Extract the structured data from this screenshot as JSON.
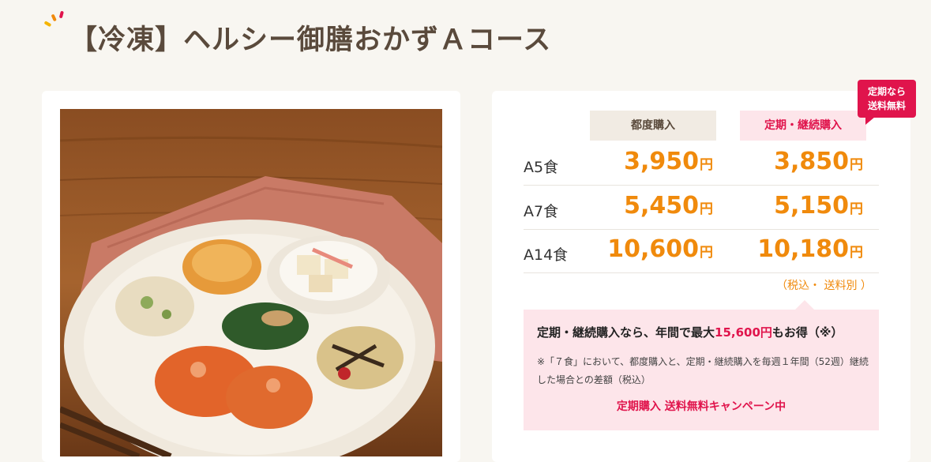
{
  "page": {
    "title": "【冷凍】ヘルシー御膳おかずＡコース"
  },
  "pricing": {
    "columns": {
      "normal": "都度購入",
      "subscription": "定期・継続購入"
    },
    "badge": {
      "line1": "定期なら",
      "line2": "送料無料"
    },
    "rows": [
      {
        "label": "A5食",
        "normal_price": "3,950",
        "subscription_price": "3,850"
      },
      {
        "label": "A7食",
        "normal_price": "5,450",
        "subscription_price": "5,150"
      },
      {
        "label": "A14食",
        "normal_price": "10,600",
        "subscription_price": "10,180"
      }
    ],
    "yen": "円",
    "tax_note": "（税込・ 送料別 ）"
  },
  "info": {
    "main_before": "定期・継続購入なら、年間で最大",
    "main_highlight": "15,600円",
    "main_after": "もお得（※）",
    "note": "※「７食」において、都度購入と、定期・継続購入を毎週１年間（52週）継続した場合との差額（税込）",
    "campaign": "定期購入 送料無料キャンペーン中"
  },
  "colors": {
    "accent_orange": "#f08a0c",
    "accent_red": "#e0144c",
    "title_brown": "#5a4a3c"
  }
}
